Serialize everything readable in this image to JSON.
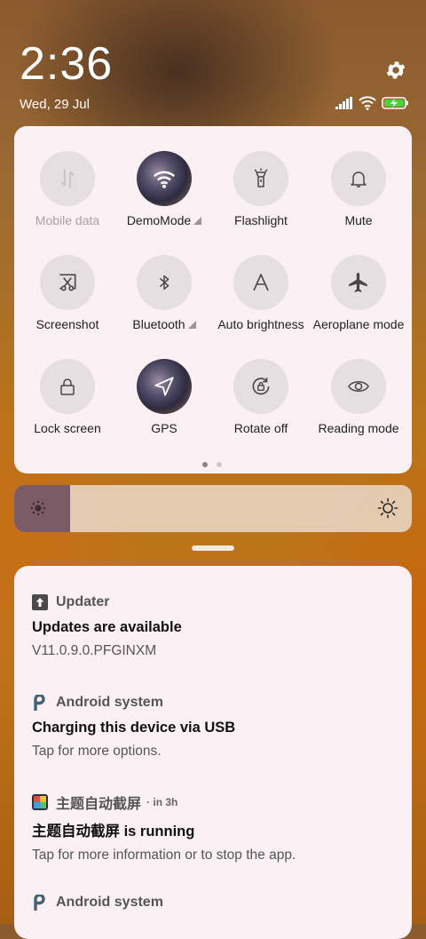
{
  "status_bar": {
    "time": "2:36",
    "date": "Wed, 29 Jul",
    "icons": [
      "signal-icon",
      "wifi-icon",
      "battery-charging-icon"
    ],
    "battery_color": "#4cd137"
  },
  "quick_settings": {
    "tiles": [
      {
        "label": "Mobile data",
        "icon": "mobile-data-icon",
        "active": false,
        "disabled": true
      },
      {
        "label": "DemoMode",
        "icon": "wifi-icon",
        "active": true,
        "expandable": true
      },
      {
        "label": "Flashlight",
        "icon": "flashlight-icon",
        "active": false
      },
      {
        "label": "Mute",
        "icon": "bell-icon",
        "active": false
      },
      {
        "label": "Screenshot",
        "icon": "screenshot-icon",
        "active": false
      },
      {
        "label": "Bluetooth",
        "icon": "bluetooth-icon",
        "active": false,
        "expandable": true
      },
      {
        "label": "Auto brightness",
        "icon": "auto-brightness-icon",
        "active": false
      },
      {
        "label": "Aeroplane mode",
        "icon": "airplane-icon",
        "active": false
      },
      {
        "label": "Lock screen",
        "icon": "lock-icon",
        "active": false
      },
      {
        "label": "GPS",
        "icon": "location-icon",
        "active": true
      },
      {
        "label": "Rotate off",
        "icon": "rotate-lock-icon",
        "active": false
      },
      {
        "label": "Reading mode",
        "icon": "eye-icon",
        "active": false
      }
    ],
    "page_count": 2,
    "current_page": 1
  },
  "brightness": {
    "level": 0.14
  },
  "notifications": [
    {
      "app": "Updater",
      "icon": "updater-icon",
      "time": "",
      "title": "Updates are available",
      "body": "V11.0.9.0.PFGINXM"
    },
    {
      "app": "Android system",
      "icon": "android-system-icon",
      "time": "",
      "title": "Charging this device via USB",
      "body": "Tap for more options."
    },
    {
      "app": "主题自动截屏",
      "icon": "theme-app-icon",
      "time": "in 3h",
      "title": "主题自动截屏 is running",
      "body": "Tap for more information or to stop the app."
    },
    {
      "app": "Android system",
      "icon": "android-system-icon",
      "time": "",
      "title": "",
      "body": ""
    }
  ]
}
